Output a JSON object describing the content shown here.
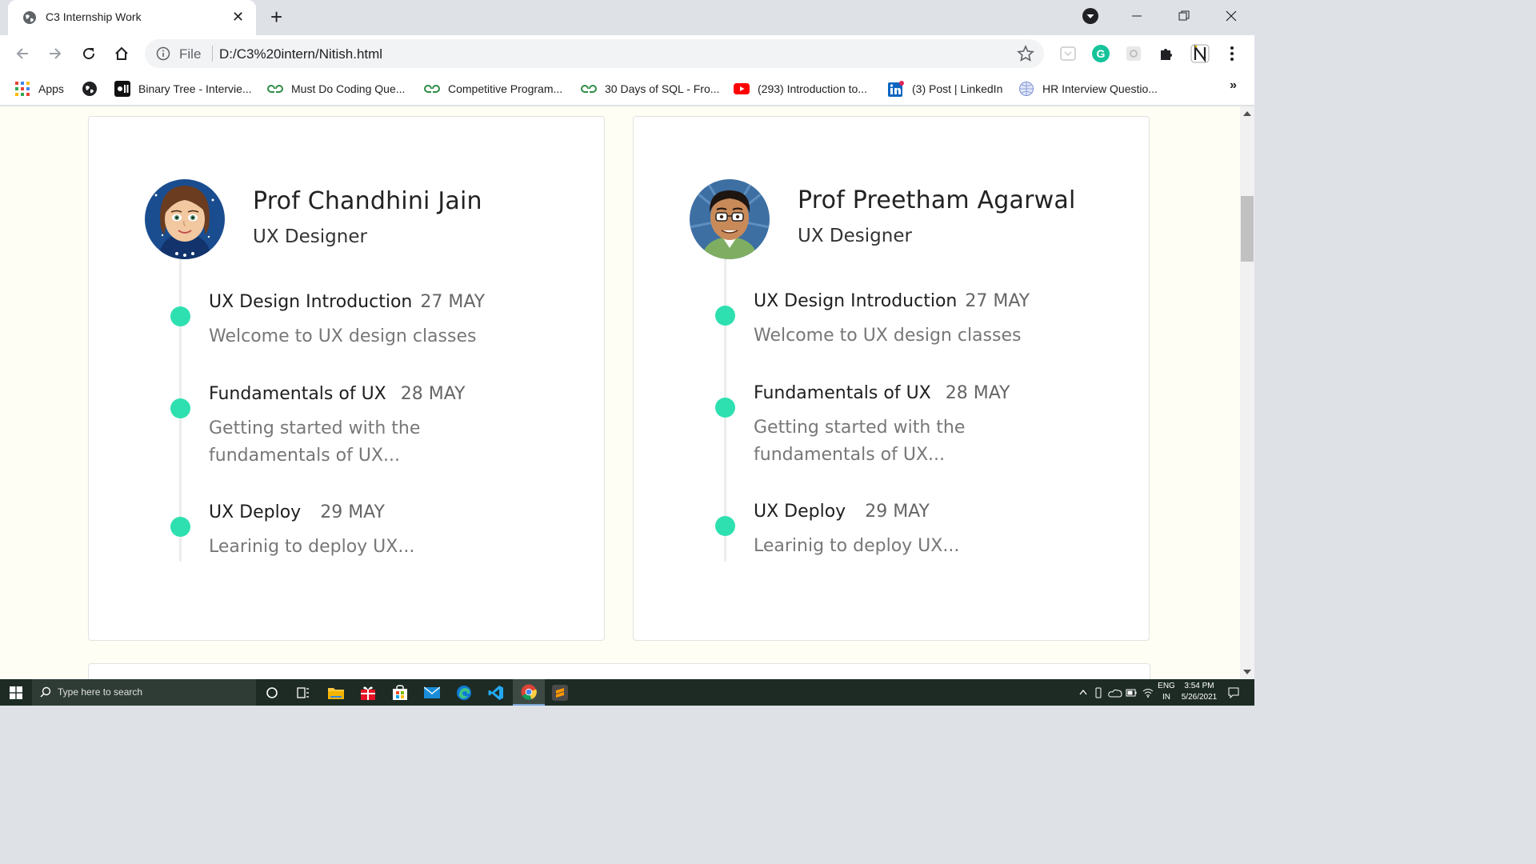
{
  "browser": {
    "tab": {
      "title": "C3 Internship Work",
      "favicon": "globe-icon"
    },
    "address": {
      "scheme": "File",
      "url": "D:/C3%20intern/Nitish.html"
    },
    "bookmarks": [
      {
        "label": "Apps",
        "icon": "apps-grid-icon"
      },
      {
        "label": "",
        "icon": "globe-icon"
      },
      {
        "label": "Binary Tree - Intervie...",
        "icon": "interviewbit-icon"
      },
      {
        "label": "Must Do Coding Que...",
        "icon": "geeksforgeeks-icon"
      },
      {
        "label": "Competitive Program...",
        "icon": "geeksforgeeks-icon"
      },
      {
        "label": "30 Days of SQL - Fro...",
        "icon": "geeksforgeeks-icon"
      },
      {
        "label": "(293) Introduction to...",
        "icon": "youtube-icon"
      },
      {
        "label": "(3) Post | LinkedIn",
        "icon": "linkedin-icon"
      },
      {
        "label": "HR Interview Questio...",
        "icon": "globe-icon"
      }
    ],
    "bookmarks_more": "»"
  },
  "page": {
    "cards": [
      {
        "name": "Prof Chandhini Jain",
        "role": "UX Designer",
        "avatar": "female-avatar",
        "timeline": [
          {
            "title": "UX Design Introduction",
            "date": "27 MAY",
            "desc": "Welcome to UX design classes"
          },
          {
            "title": "Fundamentals of UX",
            "date": "28 MAY",
            "desc": "Getting started with the fundamentals of UX..."
          },
          {
            "title": "UX Deploy",
            "date": "29 MAY",
            "desc": "Learinig to deploy UX..."
          }
        ]
      },
      {
        "name": "Prof Preetham Agarwal",
        "role": "UX Designer",
        "avatar": "male-avatar",
        "timeline": [
          {
            "title": "UX Design Introduction",
            "date": "27 MAY",
            "desc": "Welcome to UX design classes"
          },
          {
            "title": "Fundamentals of UX",
            "date": "28 MAY",
            "desc": "Getting started with the fundamentals of UX..."
          },
          {
            "title": "UX Deploy",
            "date": "29 MAY",
            "desc": "Learinig to deploy UX..."
          }
        ]
      }
    ],
    "accent_color": "#2ee0b0",
    "background_color": "#fefef4"
  },
  "taskbar": {
    "search_placeholder": "Type here to search",
    "lang": "ENG",
    "region": "IN",
    "time": "3:54 PM",
    "date": "5/26/2021"
  }
}
